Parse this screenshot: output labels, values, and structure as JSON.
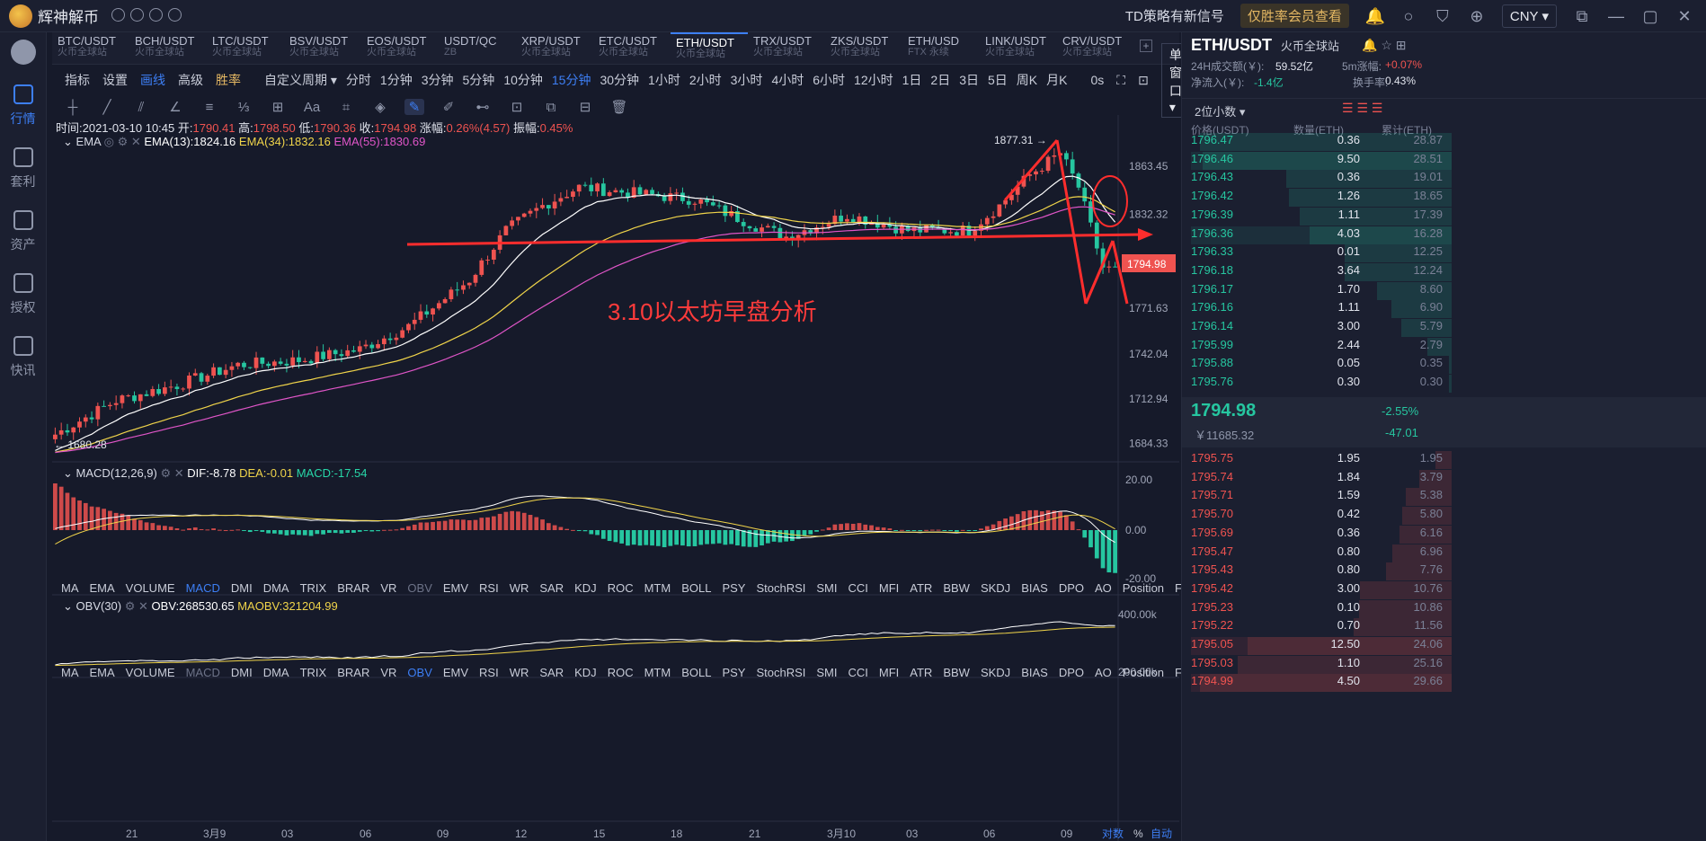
{
  "app": {
    "name": "辉神解币"
  },
  "titlebar": {
    "signal": "TD策略有新信号",
    "vip": "仅胜率会员查看",
    "currency": "CNY ▾"
  },
  "sidebar": [
    {
      "label": "行情",
      "active": true
    },
    {
      "label": "套利"
    },
    {
      "label": "资产"
    },
    {
      "label": "授权"
    },
    {
      "label": "快讯"
    }
  ],
  "symbols": [
    {
      "pair": "BTC/USDT",
      "ex": "火币全球站"
    },
    {
      "pair": "BCH/USDT",
      "ex": "火币全球站"
    },
    {
      "pair": "LTC/USDT",
      "ex": "火币全球站"
    },
    {
      "pair": "BSV/USDT",
      "ex": "火币全球站"
    },
    {
      "pair": "EOS/USDT",
      "ex": "火币全球站"
    },
    {
      "pair": "USDT/QC",
      "ex": "ZB"
    },
    {
      "pair": "XRP/USDT",
      "ex": "火币全球站"
    },
    {
      "pair": "ETC/USDT",
      "ex": "火币全球站"
    },
    {
      "pair": "ETH/USDT",
      "ex": "火币全球站",
      "active": true
    },
    {
      "pair": "TRX/USDT",
      "ex": "火币全球站"
    },
    {
      "pair": "ZKS/USDT",
      "ex": "火币全球站"
    },
    {
      "pair": "ETH/USD",
      "ex": "FTX 永续"
    },
    {
      "pair": "LINK/USDT",
      "ex": "火币全球站"
    },
    {
      "pair": "CRV/USDT",
      "ex": "火币全球站"
    }
  ],
  "toolbar": {
    "indicator": "指标",
    "settings": "设置",
    "draw": "画线",
    "advanced": "高级",
    "winrate": "胜率",
    "custom": "自定义周期 ▾",
    "periods": [
      "分时",
      "1分钟",
      "3分钟",
      "5分钟",
      "10分钟",
      "15分钟",
      "30分钟",
      "1小时",
      "2小时",
      "3小时",
      "4小时",
      "6小时",
      "12小时",
      "1日",
      "2日",
      "3日",
      "5日",
      "周K",
      "月K"
    ],
    "active_period": "15分钟",
    "timer": "0s",
    "window": "单窗口 ▾"
  },
  "drawtools": [
    "┼",
    "╱",
    "⫽",
    "∠",
    "≡",
    "⅓",
    "⊞",
    "Aa",
    "⌗",
    "◈",
    "✎",
    "✐",
    "⊷",
    "⊡",
    "⧉",
    "⊟",
    "🗑"
  ],
  "ohlc": {
    "time": "时间:2021-03-10 10:45",
    "open_l": "开:",
    "open": "1790.41",
    "high_l": "高:",
    "high": "1798.50",
    "low_l": "低:",
    "low": "1790.36",
    "close_l": "收:",
    "close": "1794.98",
    "chg_l": "涨幅:",
    "chg": "0.26%(4.57)",
    "amp_l": "振幅:",
    "amp": "0.45%"
  },
  "ema": {
    "name": "EMA",
    "e13": "EMA(13):1824.16",
    "e34": "EMA(34):1832.16",
    "e55": "EMA(55):1830.69"
  },
  "annotation": "3.10以太坊早盘分析",
  "price_axis": [
    "1863.45",
    "1832.32",
    "1801.72",
    "1771.63",
    "1742.04",
    "1712.94",
    "1684.33"
  ],
  "price_tag": "1794.98",
  "hi_label": "1877.31 →",
  "lo_label": "← 1680.28",
  "macd": {
    "name": "MACD(12,26,9)",
    "dif": "DIF:-8.78",
    "dea": "DEA:-0.01",
    "macd": "MACD:-17.54",
    "axis": [
      "20.00",
      "0.00",
      "-20.00"
    ]
  },
  "obv": {
    "name": "OBV(30)",
    "obv": "OBV:268530.65",
    "maobv": "MAOBV:321204.99",
    "axis": [
      "400.00k",
      "200.00k"
    ]
  },
  "indicators": [
    "MA",
    "EMA",
    "VOLUME",
    "MACD",
    "DMI",
    "DMA",
    "TRIX",
    "BRAR",
    "VR",
    "OBV",
    "EMV",
    "RSI",
    "WR",
    "SAR",
    "KDJ",
    "ROC",
    "MTM",
    "BOLL",
    "PSY",
    "StochRSI",
    "SMI",
    "CCI",
    "MFI",
    "ATR",
    "BBW",
    "SKDJ",
    "BIAS",
    "DPO",
    "AO",
    "Position",
    "Fundflow"
  ],
  "time_axis": [
    "21",
    "3月9",
    "03",
    "06",
    "09",
    "12",
    "15",
    "18",
    "21",
    "3月10",
    "03",
    "06",
    "09"
  ],
  "axis_opts": [
    "对数",
    "%",
    "自动"
  ],
  "chart_data": {
    "type": "candlestick",
    "series": "ETH/USDT 15分钟",
    "high": 1877.31,
    "low": 1680.28,
    "last": 1794.98,
    "ylim": [
      1684.33,
      1863.45
    ]
  },
  "orderbook": {
    "pair": "ETH/USDT",
    "exchange": "火币全球站",
    "vol_label": "24H成交额(￥):",
    "vol": "59.52亿",
    "inflow_label": "净流入(￥):",
    "inflow": "-1.4亿",
    "r1_label": "5m涨幅:",
    "r1": "+0.07%",
    "r2_label": "换手率:",
    "r2": "0.43%",
    "decimals": "2位小数 ▾",
    "cols": [
      "价格(USDT)",
      "数量(ETH)",
      "累计(ETH)"
    ],
    "asks": [
      [
        "1796.47",
        "0.36",
        "28.87"
      ],
      [
        "1796.46",
        "9.50",
        "28.51"
      ],
      [
        "1796.43",
        "0.36",
        "19.01"
      ],
      [
        "1796.42",
        "1.26",
        "18.65"
      ],
      [
        "1796.39",
        "1.11",
        "17.39"
      ],
      [
        "1796.36",
        "4.03",
        "16.28"
      ],
      [
        "1796.33",
        "0.01",
        "12.25"
      ],
      [
        "1796.18",
        "3.64",
        "12.24"
      ],
      [
        "1796.17",
        "1.70",
        "8.60"
      ],
      [
        "1796.16",
        "1.11",
        "6.90"
      ],
      [
        "1796.14",
        "3.00",
        "5.79"
      ],
      [
        "1795.99",
        "2.44",
        "2.79"
      ],
      [
        "1795.88",
        "0.05",
        "0.35"
      ],
      [
        "1795.76",
        "0.30",
        "0.30"
      ]
    ],
    "last": "1794.98",
    "last_cny": "￥11685.32",
    "chg": "-2.55%",
    "chg_abs": "-47.01",
    "bids": [
      [
        "1795.75",
        "1.95",
        "1.95"
      ],
      [
        "1795.74",
        "1.84",
        "3.79"
      ],
      [
        "1795.71",
        "1.59",
        "5.38"
      ],
      [
        "1795.70",
        "0.42",
        "5.80"
      ],
      [
        "1795.69",
        "0.36",
        "6.16"
      ],
      [
        "1795.47",
        "0.80",
        "6.96"
      ],
      [
        "1795.43",
        "0.80",
        "7.76"
      ],
      [
        "1795.42",
        "3.00",
        "10.76"
      ],
      [
        "1795.23",
        "0.10",
        "10.86"
      ],
      [
        "1795.22",
        "0.70",
        "11.56"
      ],
      [
        "1795.05",
        "12.50",
        "24.06"
      ],
      [
        "1795.03",
        "1.10",
        "25.16"
      ],
      [
        "1794.99",
        "4.50",
        "29.66"
      ]
    ]
  },
  "colors": {
    "up": "#ef5350",
    "down": "#26c6a0",
    "accent": "#3d7ff5",
    "bg": "#161a2a"
  }
}
